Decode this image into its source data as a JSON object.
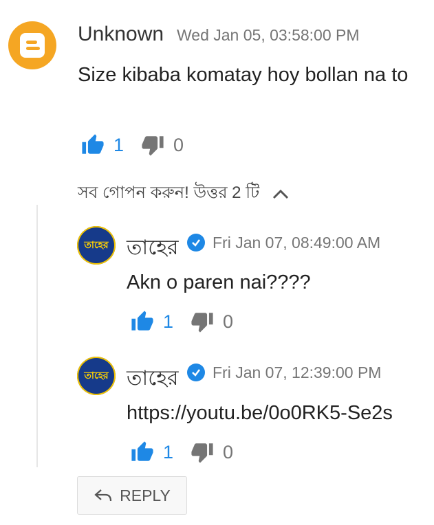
{
  "comment": {
    "author": "Unknown",
    "timestamp": "Wed Jan 05, 03:58:00 PM",
    "text": "Size kibaba komatay hoy bollan na to",
    "likes": "1",
    "dislikes": "0",
    "avatar_icon": "blogger-icon"
  },
  "replies_toggle": {
    "label": "সব গোপন করুন! উত্তর 2 টি"
  },
  "replies": [
    {
      "author": "তাহের",
      "avatar_text": "তাহের",
      "timestamp": "Fri Jan 07, 08:49:00 AM",
      "text": "Akn o paren nai????",
      "likes": "1",
      "dislikes": "0"
    },
    {
      "author": "তাহের",
      "avatar_text": "তাহের",
      "timestamp": "Fri Jan 07, 12:39:00 PM",
      "text": "https://youtu.be/0o0RK5-Se2s",
      "likes": "1",
      "dislikes": "0"
    }
  ],
  "reply_button": {
    "label": "REPLY"
  },
  "colors": {
    "accent": "#1e88e5",
    "blogger": "#f5a623",
    "muted": "#757575"
  }
}
